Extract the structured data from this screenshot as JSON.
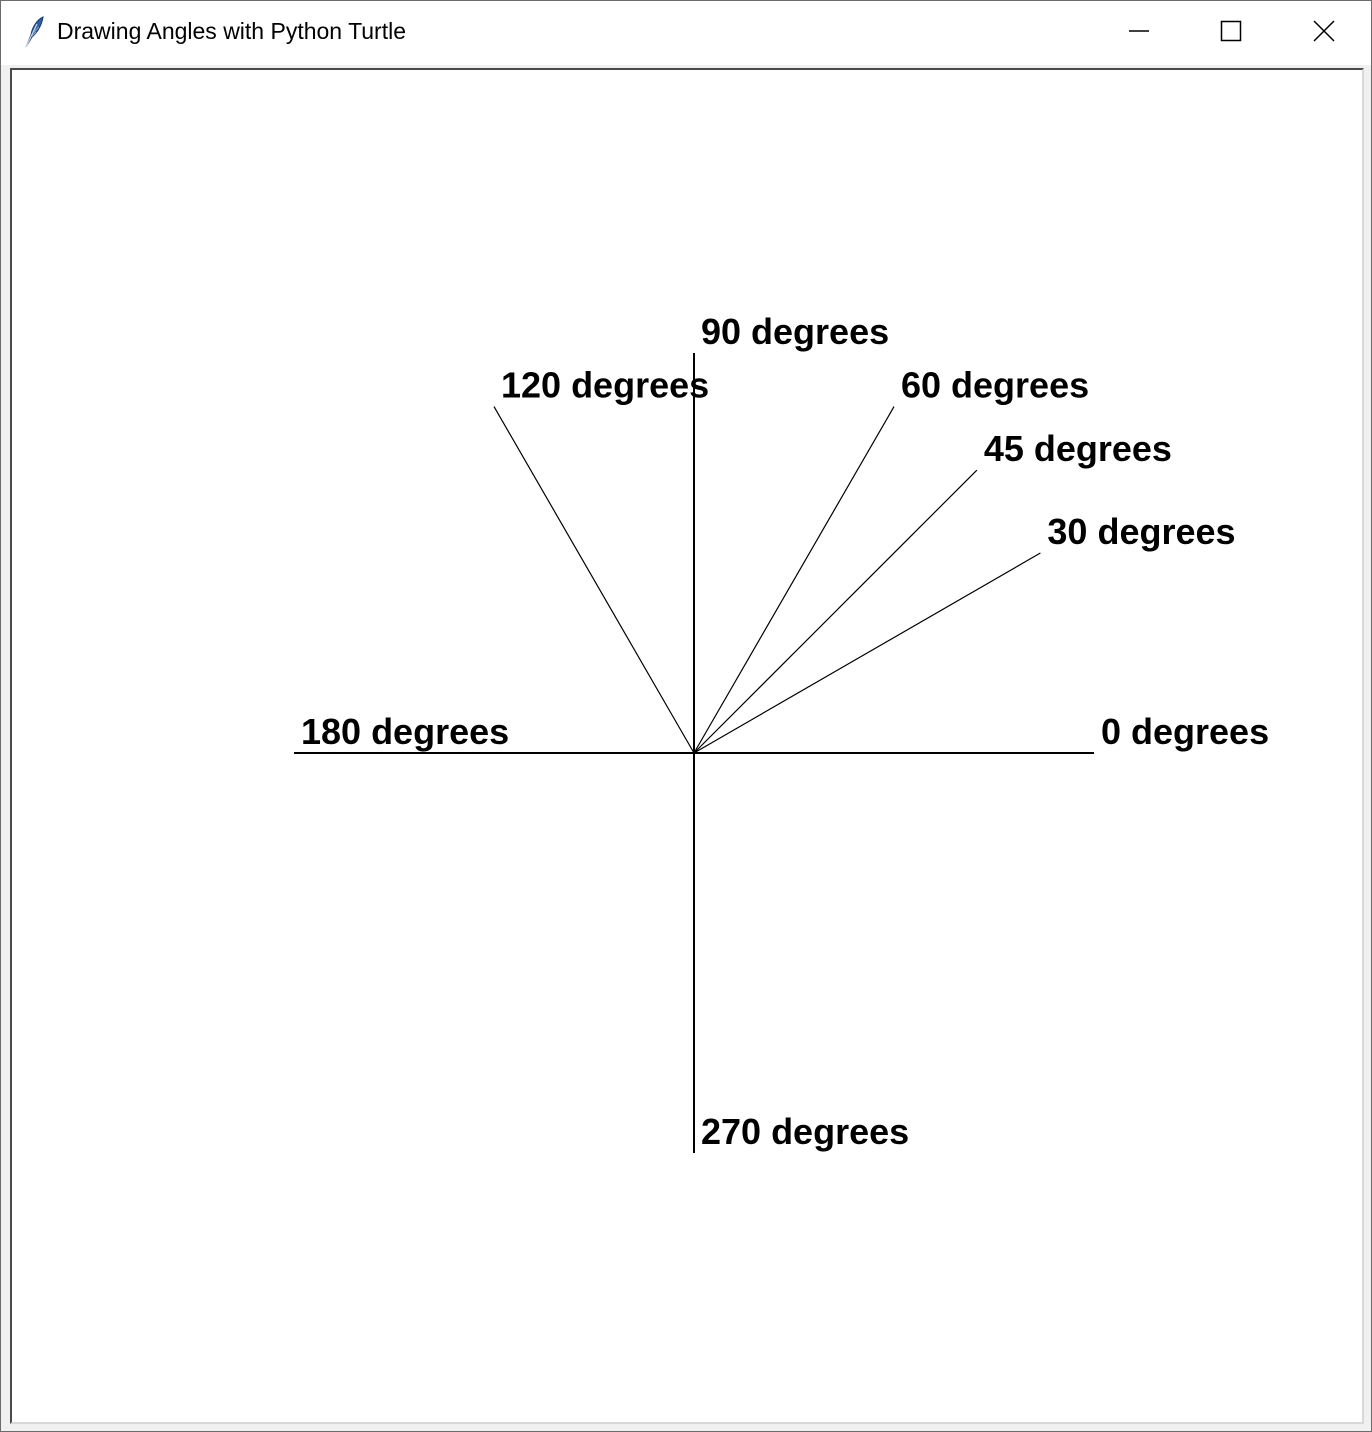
{
  "window": {
    "title": "Drawing Angles with Python Turtle",
    "icon": "feather-icon",
    "controls": [
      "minimize-icon",
      "maximize-icon",
      "close-icon"
    ]
  },
  "canvas": {
    "background": "#ffffff",
    "line_color": "#000000",
    "angles": [
      {
        "degrees": 0,
        "label": "0 degrees"
      },
      {
        "degrees": 30,
        "label": "30 degrees"
      },
      {
        "degrees": 45,
        "label": "45 degrees"
      },
      {
        "degrees": 60,
        "label": "60 degrees"
      },
      {
        "degrees": 90,
        "label": "90 degrees"
      },
      {
        "degrees": 120,
        "label": "120 degrees"
      },
      {
        "degrees": 180,
        "label": "180 degrees"
      },
      {
        "degrees": 270,
        "label": "270 degrees"
      }
    ]
  }
}
